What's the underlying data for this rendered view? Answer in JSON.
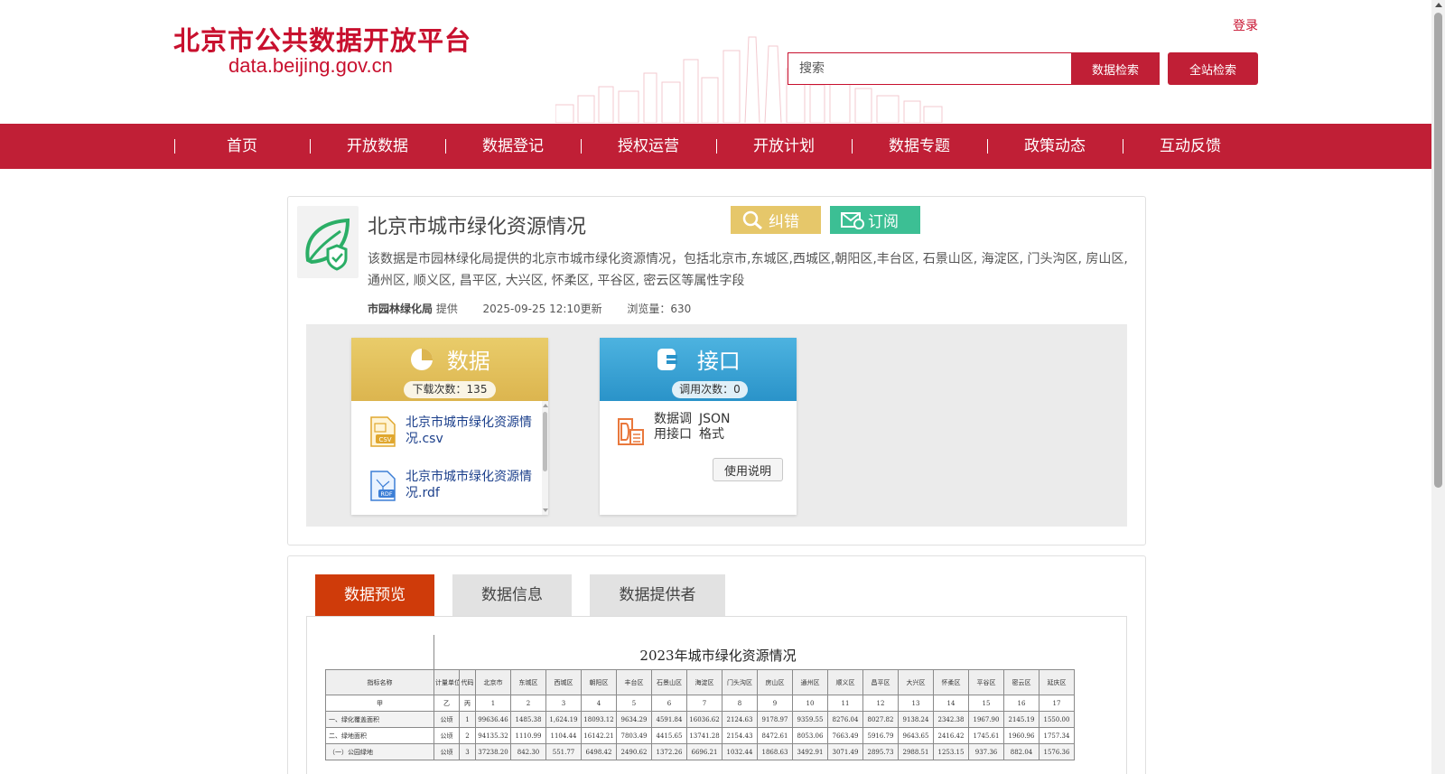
{
  "header": {
    "logo_cn": "北京市公共数据开放平台",
    "logo_en": "data.beijing.gov.cn",
    "login": "登录",
    "search_placeholder": "搜索",
    "data_search": "数据检索",
    "site_search": "全站检索"
  },
  "nav": {
    "items": [
      "首页",
      "开放数据",
      "数据登记",
      "授权运营",
      "开放计划",
      "数据专题",
      "政策动态",
      "互动反馈"
    ]
  },
  "dataset": {
    "title": "北京市城市绿化资源情况",
    "correct": "纠错",
    "subscribe": "订阅",
    "description": "该数据是市园林绿化局提供的北京市城市绿化资源情况，包括北京市,东城区,西城区,朝阳区,丰台区, 石景山区, 海淀区, 门头沟区, 房山区, 通州区, 顺义区, 昌平区, 大兴区, 怀柔区, 平谷区, 密云区等属性字段",
    "provider": "市园林绿化局",
    "provided_suffix": "提供",
    "updated": "2025-09-25 12:10更新",
    "views": "浏览量：630"
  },
  "data_panel": {
    "heading": "数据",
    "downloads": "下载次数：135",
    "files": [
      {
        "name": "北京市城市绿化资源情况.csv",
        "type": "CSV"
      },
      {
        "name": "北京市城市绿化资源情况.rdf",
        "type": "RDF"
      }
    ]
  },
  "api_panel": {
    "heading": "接口",
    "calls": "调用次数：0",
    "label": "数据调用接口",
    "format": "JSON格式",
    "usage": "使用说明"
  },
  "tabs": {
    "preview": "数据预览",
    "info": "数据信息",
    "provider": "数据提供者"
  },
  "preview": {
    "title": "2023年城市绿化资源情况",
    "header": [
      "指标名称",
      "计量单位",
      "代码",
      "北京市",
      "东城区",
      "西城区",
      "朝阳区",
      "丰台区",
      "石景山区",
      "海淀区",
      "门头沟区",
      "房山区",
      "通州区",
      "顺义区",
      "昌平区",
      "大兴区",
      "怀柔区",
      "平谷区",
      "密云区",
      "延庆区"
    ],
    "rows": [
      [
        "甲",
        "乙",
        "丙",
        "1",
        "2",
        "3",
        "4",
        "5",
        "6",
        "7",
        "8",
        "9",
        "10",
        "11",
        "12",
        "13",
        "14",
        "15",
        "16",
        "17"
      ],
      [
        "一、绿化覆盖面积",
        "公顷",
        "1",
        "99636.46",
        "1485.38",
        "1,624.19",
        "18093.12",
        "9634.29",
        "4591.84",
        "16036.62",
        "2124.63",
        "9178.97",
        "9359.55",
        "8276.04",
        "8027.82",
        "9138.24",
        "2342.38",
        "1967.90",
        "2145.19",
        "1550.00"
      ],
      [
        "二、绿地面积",
        "公顷",
        "2",
        "94135.32",
        "1110.99",
        "1104.44",
        "16142.21",
        "7803.49",
        "4415.65",
        "13741.28",
        "2154.43",
        "8472.61",
        "8053.06",
        "7663.49",
        "5916.79",
        "9643.65",
        "2416.42",
        "1745.61",
        "1960.96",
        "1757.34"
      ],
      [
        "（一）公园绿地",
        "公顷",
        "3",
        "37238.20",
        "842.30",
        "551.77",
        "6498.42",
        "2490.62",
        "1372.26",
        "6696.21",
        "1032.44",
        "1868.63",
        "3492.91",
        "3071.49",
        "2895.73",
        "2988.51",
        "1253.15",
        "937.36",
        "882.04",
        "1576.36"
      ]
    ]
  }
}
